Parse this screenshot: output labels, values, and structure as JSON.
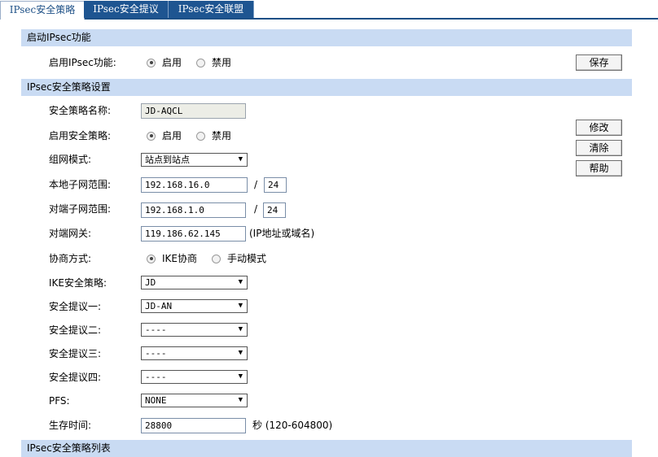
{
  "tabs": [
    {
      "label": "IPsec安全策略",
      "active": true
    },
    {
      "label": "IPsec安全提议",
      "active": false
    },
    {
      "label": "IPsec安全联盟",
      "active": false
    }
  ],
  "enable_section": {
    "title": "启动IPsec功能",
    "label": "启用IPsec功能:",
    "option_on": "启用",
    "option_off": "禁用",
    "selected": "启用",
    "save_button": "保存"
  },
  "policy_section": {
    "title": "IPsec安全策略设置",
    "name_label": "安全策略名称:",
    "name_value": "JD-AQCL",
    "enable_label": "启用安全策略:",
    "enable_on": "启用",
    "enable_off": "禁用",
    "network_mode_label": "组网模式:",
    "network_mode_value": "站点到站点",
    "local_subnet_label": "本地子网范围:",
    "local_subnet_ip": "192.168.16.0",
    "local_subnet_mask": "24",
    "remote_subnet_label": "对端子网范围:",
    "remote_subnet_ip": "192.168.1.0",
    "remote_subnet_mask": "24",
    "slash": "/",
    "remote_gateway_label": "对端网关:",
    "remote_gateway_value": "119.186.62.145",
    "remote_gateway_note": "(IP地址或域名)",
    "negotiation_label": "协商方式:",
    "negotiation_ike": "IKE协商",
    "negotiation_manual": "手动模式",
    "ike_policy_label": "IKE安全策略:",
    "ike_policy_value": "JD",
    "proposal1_label": "安全提议一:",
    "proposal1_value": "JD-AN",
    "proposal2_label": "安全提议二:",
    "proposal2_value": "----",
    "proposal3_label": "安全提议三:",
    "proposal3_value": "----",
    "proposal4_label": "安全提议四:",
    "proposal4_value": "----",
    "pfs_label": "PFS:",
    "pfs_value": "NONE",
    "lifetime_label": "生存时间:",
    "lifetime_value": "28800",
    "lifetime_note": "秒 (120-604800)",
    "modify_button": "修改",
    "clear_button": "清除",
    "help_button": "帮助"
  },
  "list_section": {
    "title": "IPsec安全策略列表"
  },
  "icons": {
    "dropdown_arrow": "▼"
  }
}
